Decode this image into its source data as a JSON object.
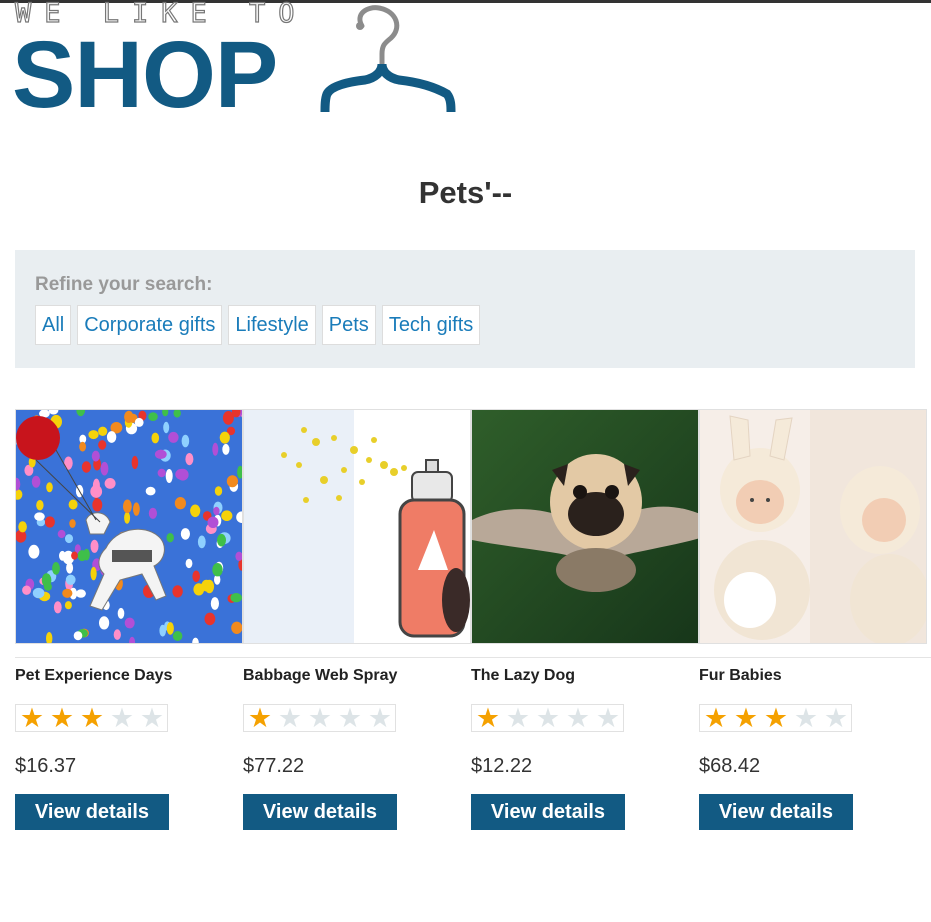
{
  "brand": {
    "tagline": "WE LIKE TO",
    "word": "SHOP",
    "colors": {
      "primary": "#125a83",
      "hanger_hook": "#8c8c8c"
    }
  },
  "page": {
    "title": "Pets'--"
  },
  "filters": {
    "label": "Refine your search:",
    "items": [
      "All",
      "Corporate gifts",
      "Lifestyle",
      "Pets",
      "Tech gifts"
    ]
  },
  "products": [
    {
      "name": "Pet Experience Days",
      "rating": 3,
      "price": "$16.37",
      "button": "View details",
      "image": "dog-with-balloons"
    },
    {
      "name": "Babbage Web Spray",
      "rating": 1,
      "price": "$77.22",
      "button": "View details",
      "image": "spray-can"
    },
    {
      "name": "The Lazy Dog",
      "rating": 1,
      "price": "$12.22",
      "button": "View details",
      "image": "pug-with-wings"
    },
    {
      "name": "Fur Babies",
      "rating": 3,
      "price": "$68.42",
      "button": "View details",
      "image": "babies-in-bunny-hats"
    }
  ],
  "rating_max": 5,
  "colors": {
    "star_on": "#f5a100",
    "star_off": "#dde4e7",
    "link": "#1a7cba",
    "filter_bg": "#e9eef1"
  }
}
